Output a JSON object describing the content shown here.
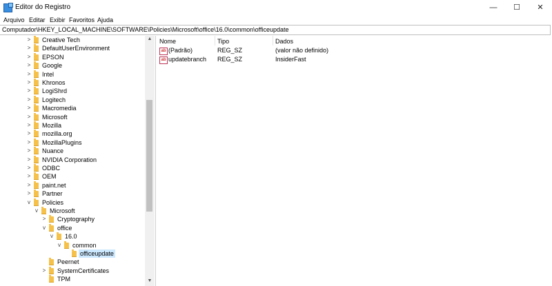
{
  "window": {
    "title": "Editor do Registro",
    "icon": "registry-editor-icon",
    "controls": {
      "minimize": "—",
      "maximize": "☐",
      "close": "✕"
    }
  },
  "menu": [
    "Arquivo",
    "Editar",
    "Exibir",
    "Favoritos",
    "Ajuda"
  ],
  "address": "Computador\\HKEY_LOCAL_MACHINE\\SOFTWARE\\Policies\\Microsoft\\office\\16.0\\common\\officeupdate",
  "tree": [
    {
      "label": "Creative Tech",
      "expander": ">"
    },
    {
      "label": "DefaultUserEnvironment",
      "expander": ">"
    },
    {
      "label": "EPSON",
      "expander": ">"
    },
    {
      "label": "Google",
      "expander": ">"
    },
    {
      "label": "Intel",
      "expander": ">"
    },
    {
      "label": "Khronos",
      "expander": ">"
    },
    {
      "label": "LogiShrd",
      "expander": ">"
    },
    {
      "label": "Logitech",
      "expander": ">"
    },
    {
      "label": "Macromedia",
      "expander": ">"
    },
    {
      "label": "Microsoft",
      "expander": ">"
    },
    {
      "label": "Mozilla",
      "expander": ">"
    },
    {
      "label": "mozilla.org",
      "expander": ">"
    },
    {
      "label": "MozillaPlugins",
      "expander": ">"
    },
    {
      "label": "Nuance",
      "expander": ">"
    },
    {
      "label": "NVIDIA Corporation",
      "expander": ">"
    },
    {
      "label": "ODBC",
      "expander": ">"
    },
    {
      "label": "OEM",
      "expander": ">"
    },
    {
      "label": "paint.net",
      "expander": ">"
    },
    {
      "label": "Partner",
      "expander": ">"
    },
    {
      "label": "Policies",
      "expander": "v"
    },
    {
      "label": "Microsoft",
      "expander": "v"
    },
    {
      "label": "Cryptography",
      "expander": ">"
    },
    {
      "label": "office",
      "expander": "v"
    },
    {
      "label": "16.0",
      "expander": "v"
    },
    {
      "label": "common",
      "expander": "v"
    },
    {
      "label": "officeupdate",
      "expander": "",
      "selected": true
    },
    {
      "label": "Peernet",
      "expander": ""
    },
    {
      "label": "SystemCertificates",
      "expander": ">"
    },
    {
      "label": "TPM",
      "expander": ""
    }
  ],
  "columns": {
    "name": "Nome",
    "type": "Tipo",
    "data": "Dados"
  },
  "values": [
    {
      "name": "(Padrão)",
      "type": "REG_SZ",
      "data": "(valor não definido)"
    },
    {
      "name": "updatebranch",
      "type": "REG_SZ",
      "data": "InsiderFast"
    }
  ],
  "scroll": {
    "up": "▲",
    "down": "▼"
  }
}
